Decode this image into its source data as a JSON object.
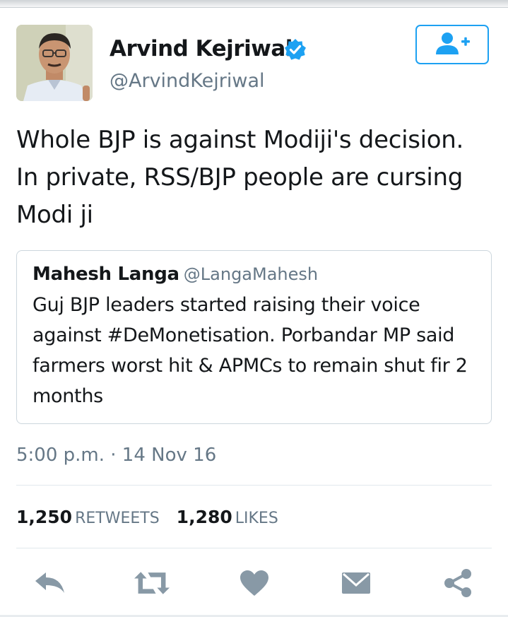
{
  "tweet": {
    "display_name": "Arvind Kejriwal",
    "handle": "@ArvindKejriwal",
    "verified": true,
    "text": "Whole BJP is against Modiji's decision. In private, RSS/BJP people are cursing Modi ji",
    "timestamp": "5:00 p.m. · 14 Nov 16"
  },
  "quoted_tweet": {
    "display_name": "Mahesh Langa",
    "handle": "@LangaMahesh",
    "text": "Guj BJP leaders started raising their voice against #DeMonetisation. Porbandar MP said farmers worst hit & APMCs to remain shut fir 2 months"
  },
  "stats": {
    "retweets_count": "1,250",
    "retweets_label": "RETWEETS",
    "likes_count": "1,280",
    "likes_label": "LIKES"
  },
  "icons": {
    "follow": "follow-user-icon",
    "verified": "verified-badge-icon",
    "reply": "reply-icon",
    "retweet": "retweet-icon",
    "like": "heart-icon",
    "direct_message": "envelope-icon",
    "share": "share-icon"
  },
  "colors": {
    "accent": "#1da1f2",
    "icon_gray": "#8899a6",
    "secondary_text": "#657786",
    "border": "#ccd6dd"
  }
}
